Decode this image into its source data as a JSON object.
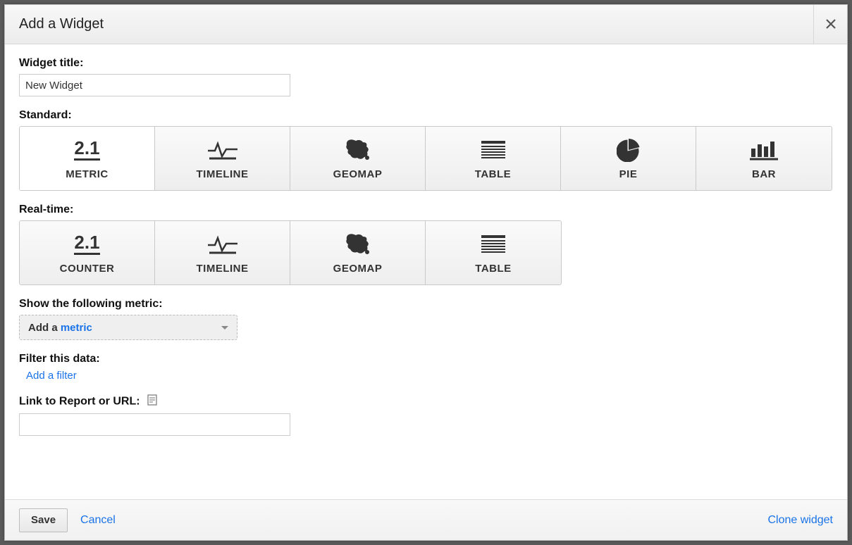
{
  "dialog": {
    "title": "Add a Widget"
  },
  "widget_title": {
    "label": "Widget title:",
    "value": "New Widget"
  },
  "standard": {
    "label": "Standard:",
    "tiles": [
      {
        "icon_text": "2.1",
        "label": "METRIC",
        "selected": true
      },
      {
        "label": "TIMELINE"
      },
      {
        "label": "GEOMAP"
      },
      {
        "label": "TABLE"
      },
      {
        "label": "PIE"
      },
      {
        "label": "BAR"
      }
    ]
  },
  "realtime": {
    "label": "Real-time:",
    "tiles": [
      {
        "icon_text": "2.1",
        "label": "COUNTER"
      },
      {
        "label": "TIMELINE"
      },
      {
        "label": "GEOMAP"
      },
      {
        "label": "TABLE"
      }
    ]
  },
  "metric": {
    "label": "Show the following metric:",
    "prefix": "Add a ",
    "keyword": "metric"
  },
  "filter": {
    "label": "Filter this data:",
    "add_text": "Add a filter"
  },
  "link_report": {
    "label": "Link to Report or URL:",
    "value": ""
  },
  "footer": {
    "save": "Save",
    "cancel": "Cancel",
    "clone": "Clone widget"
  }
}
